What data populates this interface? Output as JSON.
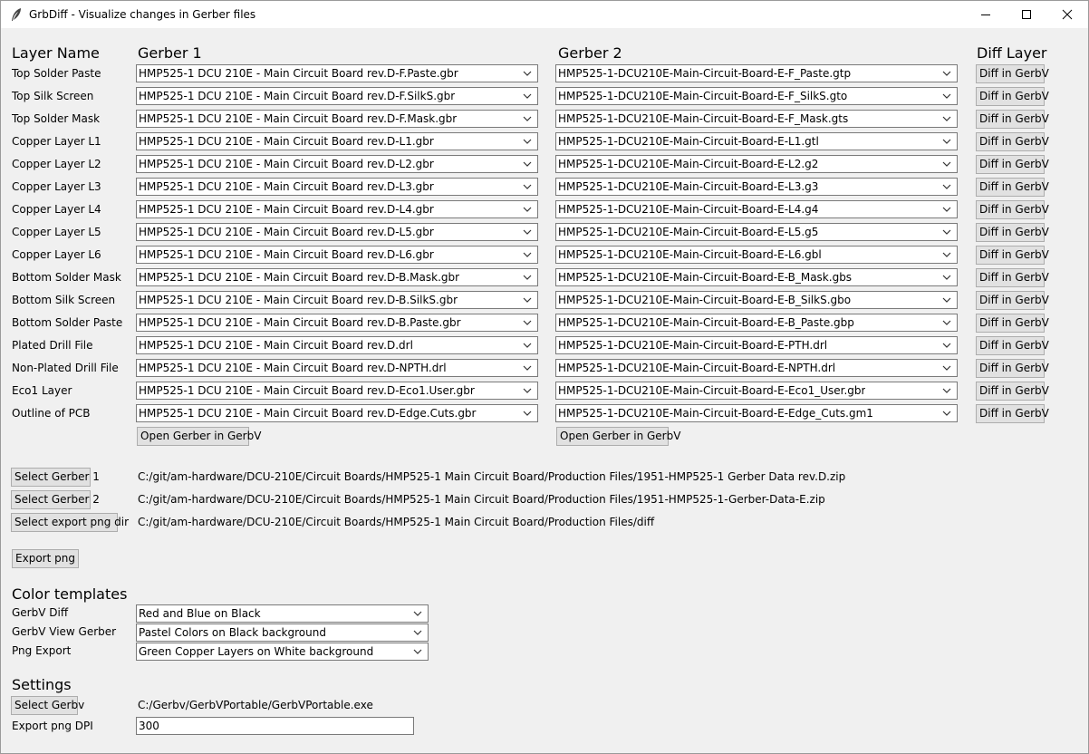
{
  "window": {
    "title": "GrbDiff - Visualize changes in Gerber files",
    "controls": {
      "minimize": "minimize-icon",
      "maximize": "maximize-icon",
      "close": "close-icon"
    }
  },
  "headers": {
    "layer_name": "Layer Name",
    "gerber1": "Gerber 1",
    "gerber2": "Gerber 2",
    "diff_layer": "Diff Layer"
  },
  "layers": [
    {
      "name": "Top Solder Paste",
      "gerber1": "HMP525-1 DCU 210E - Main Circuit Board rev.D-F.Paste.gbr",
      "gerber2": "HMP525-1-DCU210E-Main-Circuit-Board-E-F_Paste.gtp",
      "diff": "Diff in GerbV"
    },
    {
      "name": "Top Silk Screen",
      "gerber1": "HMP525-1 DCU 210E - Main Circuit Board rev.D-F.SilkS.gbr",
      "gerber2": "HMP525-1-DCU210E-Main-Circuit-Board-E-F_SilkS.gto",
      "diff": "Diff in GerbV"
    },
    {
      "name": "Top Solder Mask",
      "gerber1": "HMP525-1 DCU 210E - Main Circuit Board rev.D-F.Mask.gbr",
      "gerber2": "HMP525-1-DCU210E-Main-Circuit-Board-E-F_Mask.gts",
      "diff": "Diff in GerbV"
    },
    {
      "name": "Copper Layer L1",
      "gerber1": "HMP525-1 DCU 210E - Main Circuit Board rev.D-L1.gbr",
      "gerber2": "HMP525-1-DCU210E-Main-Circuit-Board-E-L1.gtl",
      "diff": "Diff in GerbV"
    },
    {
      "name": "Copper Layer L2",
      "gerber1": "HMP525-1 DCU 210E - Main Circuit Board rev.D-L2.gbr",
      "gerber2": "HMP525-1-DCU210E-Main-Circuit-Board-E-L2.g2",
      "diff": "Diff in GerbV"
    },
    {
      "name": "Copper Layer L3",
      "gerber1": "HMP525-1 DCU 210E - Main Circuit Board rev.D-L3.gbr",
      "gerber2": "HMP525-1-DCU210E-Main-Circuit-Board-E-L3.g3",
      "diff": "Diff in GerbV"
    },
    {
      "name": "Copper Layer L4",
      "gerber1": "HMP525-1 DCU 210E - Main Circuit Board rev.D-L4.gbr",
      "gerber2": "HMP525-1-DCU210E-Main-Circuit-Board-E-L4.g4",
      "diff": "Diff in GerbV"
    },
    {
      "name": "Copper Layer L5",
      "gerber1": "HMP525-1 DCU 210E - Main Circuit Board rev.D-L5.gbr",
      "gerber2": "HMP525-1-DCU210E-Main-Circuit-Board-E-L5.g5",
      "diff": "Diff in GerbV"
    },
    {
      "name": "Copper Layer L6",
      "gerber1": "HMP525-1 DCU 210E - Main Circuit Board rev.D-L6.gbr",
      "gerber2": "HMP525-1-DCU210E-Main-Circuit-Board-E-L6.gbl",
      "diff": "Diff in GerbV"
    },
    {
      "name": "Bottom Solder Mask",
      "gerber1": "HMP525-1 DCU 210E - Main Circuit Board rev.D-B.Mask.gbr",
      "gerber2": "HMP525-1-DCU210E-Main-Circuit-Board-E-B_Mask.gbs",
      "diff": "Diff in GerbV"
    },
    {
      "name": "Bottom Silk Screen",
      "gerber1": "HMP525-1 DCU 210E - Main Circuit Board rev.D-B.SilkS.gbr",
      "gerber2": "HMP525-1-DCU210E-Main-Circuit-Board-E-B_SilkS.gbo",
      "diff": "Diff in GerbV"
    },
    {
      "name": "Bottom Solder Paste",
      "gerber1": "HMP525-1 DCU 210E - Main Circuit Board rev.D-B.Paste.gbr",
      "gerber2": "HMP525-1-DCU210E-Main-Circuit-Board-E-B_Paste.gbp",
      "diff": "Diff in GerbV"
    },
    {
      "name": "Plated Drill File",
      "gerber1": "HMP525-1 DCU 210E - Main Circuit Board rev.D.drl",
      "gerber2": "HMP525-1-DCU210E-Main-Circuit-Board-E-PTH.drl",
      "diff": "Diff in GerbV"
    },
    {
      "name": "Non-Plated Drill File",
      "gerber1": "HMP525-1 DCU 210E - Main Circuit Board rev.D-NPTH.drl",
      "gerber2": "HMP525-1-DCU210E-Main-Circuit-Board-E-NPTH.drl",
      "diff": "Diff in GerbV"
    },
    {
      "name": "Eco1 Layer",
      "gerber1": "HMP525-1 DCU 210E - Main Circuit Board rev.D-Eco1.User.gbr",
      "gerber2": "HMP525-1-DCU210E-Main-Circuit-Board-E-Eco1_User.gbr",
      "diff": "Diff in GerbV"
    },
    {
      "name": "Outline of PCB",
      "gerber1": "HMP525-1 DCU 210E - Main Circuit Board rev.D-Edge.Cuts.gbr",
      "gerber2": "HMP525-1-DCU210E-Main-Circuit-Board-E-Edge_Cuts.gm1",
      "diff": "Diff in GerbV"
    }
  ],
  "open_buttons": {
    "gerber1": "Open Gerber in GerbV",
    "gerber2": "Open Gerber in GerbV"
  },
  "selections": {
    "gerber1": {
      "button": "Select Gerber 1",
      "path": "C:/git/am-hardware/DCU-210E/Circuit Boards/HMP525-1 Main Circuit Board/Production Files/1951-HMP525-1 Gerber Data rev.D.zip"
    },
    "gerber2": {
      "button": "Select Gerber 2",
      "path": "C:/git/am-hardware/DCU-210E/Circuit Boards/HMP525-1 Main Circuit Board/Production Files/1951-HMP525-1-Gerber-Data-E.zip"
    },
    "export_dir": {
      "button": "Select export png dir",
      "path": "C:/git/am-hardware/DCU-210E/Circuit Boards/HMP525-1 Main Circuit Board/Production Files/diff"
    }
  },
  "export_button": "Export png",
  "color_templates": {
    "heading": "Color templates",
    "items": [
      {
        "label": "GerbV Diff",
        "value": "Red and Blue on Black"
      },
      {
        "label": "GerbV View Gerber",
        "value": "Pastel Colors on Black background"
      },
      {
        "label": "Png Export",
        "value": "Green Copper Layers on White background"
      }
    ]
  },
  "settings": {
    "heading": "Settings",
    "select_gerbv": {
      "button": "Select Gerbv",
      "path": "C:/Gerbv/GerbVPortable/GerbVPortable.exe"
    },
    "dpi": {
      "label": "Export png DPI",
      "value": "300"
    }
  }
}
